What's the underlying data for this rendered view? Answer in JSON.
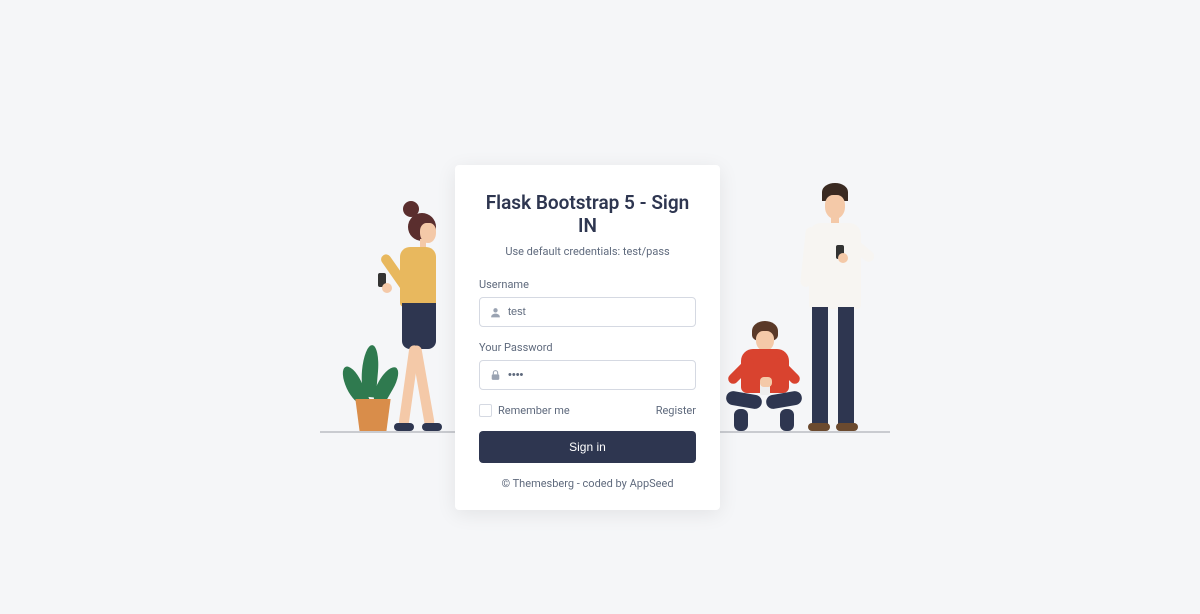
{
  "title": "Flask Bootstrap 5 - Sign IN",
  "subtitle": "Use default credentials: test/pass",
  "username": {
    "label": "Username",
    "value": "test"
  },
  "password": {
    "label": "Your Password",
    "value": "••••"
  },
  "remember": {
    "label": "Remember me",
    "checked": false
  },
  "register": "Register",
  "signin": "Sign in",
  "footer": {
    "copyright": "© Themesberg",
    "separator": " - coded by ",
    "brand": "AppSeed"
  },
  "icons": {
    "user": "user-icon",
    "lock": "lock-icon"
  },
  "colors": {
    "primary": "#2e3650",
    "accent_red": "#d9432f",
    "accent_yellow": "#e8b85e"
  }
}
